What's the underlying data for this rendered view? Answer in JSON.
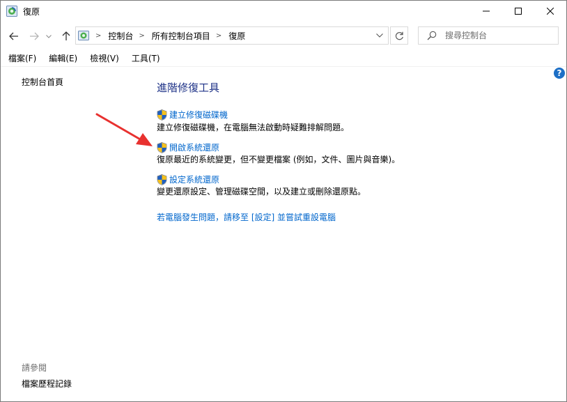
{
  "window": {
    "title": "復原",
    "app_icon": "recovery-icon",
    "controls": [
      "minimize-icon",
      "maximize-icon",
      "close-icon"
    ]
  },
  "nav": {
    "buttons": [
      "back-arrow-icon",
      "forward-arrow-icon",
      "recent-dropdown-icon",
      "up-arrow-icon"
    ],
    "breadcrumbs": [
      "控制台",
      "所有控制台項目",
      "復原"
    ],
    "search_placeholder": "搜尋控制台"
  },
  "menu": [
    "檔案(F)",
    "編輯(E)",
    "檢視(V)",
    "工具(T)"
  ],
  "left_pane": {
    "home_link": "控制台首頁",
    "see_also_label": "請參閱",
    "see_also_links": [
      "檔案歷程記錄"
    ]
  },
  "main": {
    "heading": "進階修復工具",
    "tasks": [
      {
        "title": "建立修復磁碟機",
        "description": "建立修復磁碟機，在電腦無法啟動時疑難排解問題。",
        "icon": "uac-shield-icon"
      },
      {
        "title": "開啟系統還原",
        "description": "復原最近的系統變更，但不變更檔案 (例如，文件、圖片與音樂)。",
        "icon": "uac-shield-icon"
      },
      {
        "title": "設定系統還原",
        "description": "變更還原設定、管理磁碟空間，以及建立或刪除還原點。",
        "icon": "uac-shield-icon"
      }
    ],
    "reset_link": "若電腦發生問題，請移至 [設定] 並嘗試重設電腦"
  },
  "annotation": {
    "type": "red-arrow",
    "points_to": "開啟系統還原"
  },
  "colors": {
    "link": "#0066cc",
    "heading": "#1e3287",
    "arrow": "#e8312f",
    "help": "#1c6fc6"
  }
}
